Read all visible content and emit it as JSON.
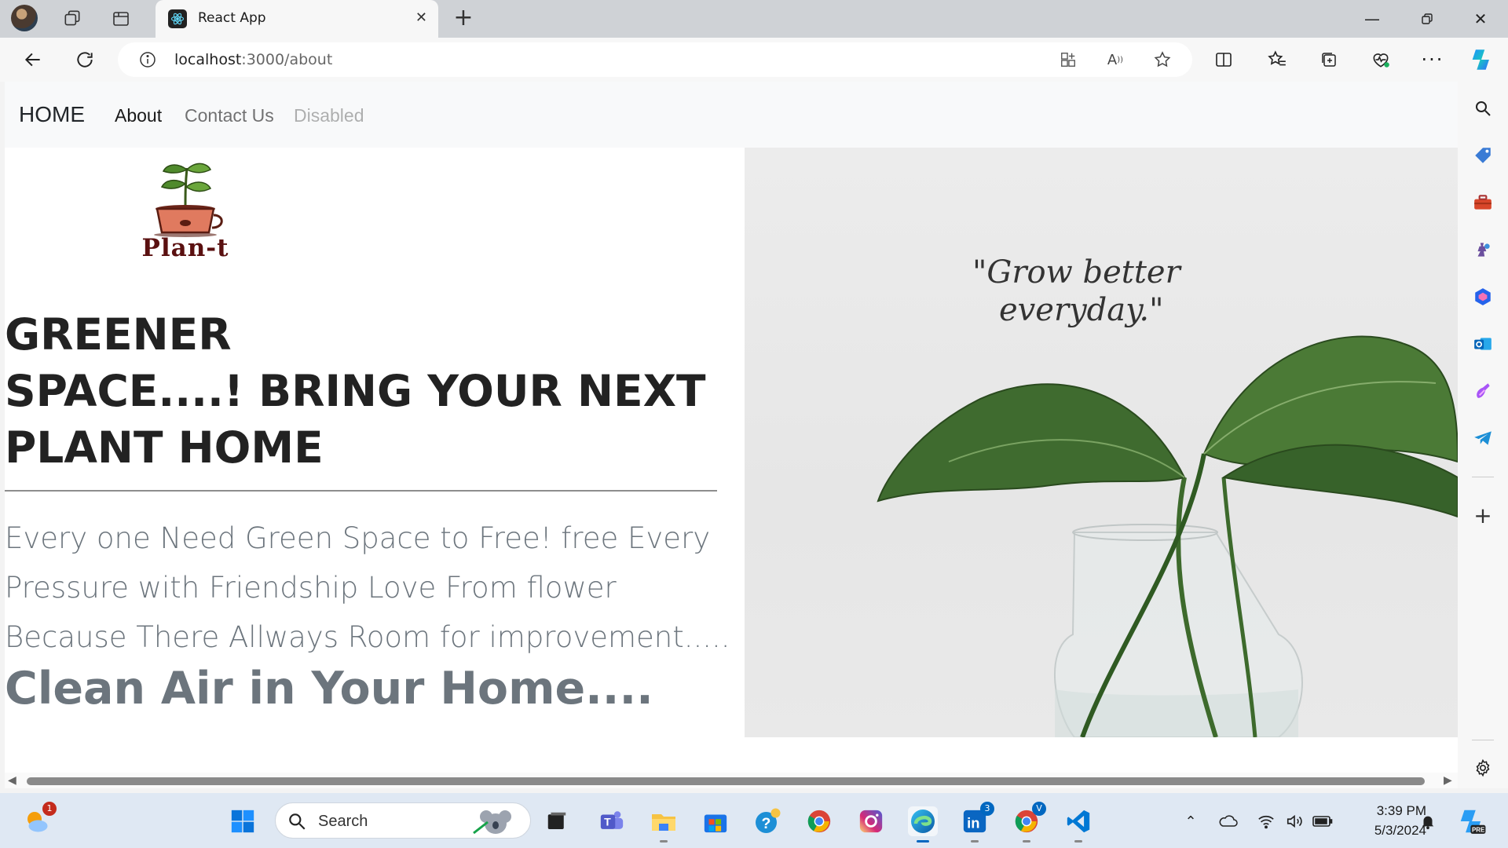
{
  "browser": {
    "tab": {
      "title": "React App",
      "icon": "react-icon"
    },
    "url": {
      "host": "localhost",
      "path": ":3000/about"
    },
    "window_controls": [
      "minimize-icon",
      "restore-icon",
      "close-icon"
    ]
  },
  "site": {
    "nav": {
      "brand": "HOME",
      "links": [
        {
          "label": "About",
          "state": "active"
        },
        {
          "label": "Contact Us",
          "state": "normal"
        },
        {
          "label": "Disabled",
          "state": "disabled"
        }
      ]
    },
    "logo_text": "Plan-t",
    "headline_lines": [
      "GREENER",
      "SPACE....! BRING YOUR NEXT",
      "PLANT HOME"
    ],
    "lead_lines": [
      "Every one Need Green Space to Free! free Every",
      "Pressure with Friendship Love From flower",
      "Because There Allways Room for improvement....."
    ],
    "subhead": "Clean Air in Your Home....",
    "hero": {
      "quote_line1": "\"Grow better",
      "quote_line2": "everyday.\""
    }
  },
  "sidebar": {
    "icons": [
      "search-icon",
      "tag-icon",
      "toolbox-icon",
      "games-icon",
      "microsoft365-icon",
      "outlook-icon",
      "designer-icon",
      "telegram-icon",
      "add-icon",
      "settings-icon"
    ]
  },
  "taskbar": {
    "search_label": "Search",
    "weather_badge": "1",
    "linkedin_badge": "3",
    "chrome_badge": "V",
    "time": "3:39 PM",
    "date": "5/3/2024"
  },
  "colors": {
    "navbar_bg": "#f8f9fa",
    "muted_text": "#6c757d",
    "accent": "#0067c0"
  }
}
